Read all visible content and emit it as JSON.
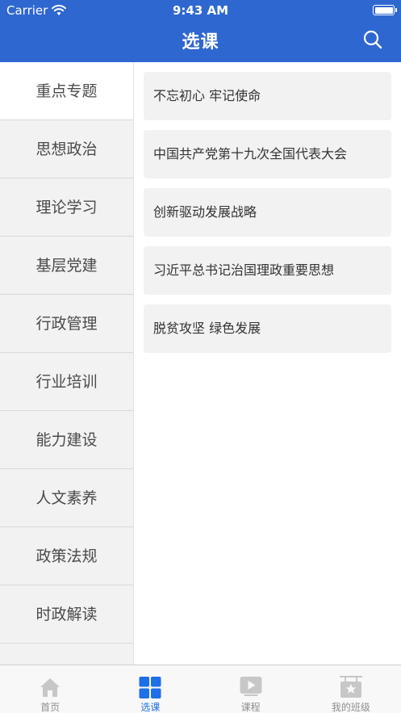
{
  "status_bar": {
    "carrier": "Carrier",
    "time": "9:43 AM"
  },
  "header": {
    "title": "选课",
    "search_icon": "search-icon"
  },
  "sidebar": {
    "items": [
      {
        "label": "重点专题",
        "active": true
      },
      {
        "label": "思想政治"
      },
      {
        "label": "理论学习"
      },
      {
        "label": "基层党建"
      },
      {
        "label": "行政管理"
      },
      {
        "label": "行业培训"
      },
      {
        "label": "能力建设"
      },
      {
        "label": "人文素养"
      },
      {
        "label": "政策法规"
      },
      {
        "label": "时政解读"
      },
      {
        "label": ""
      }
    ]
  },
  "topics": [
    {
      "label": "不忘初心 牢记使命"
    },
    {
      "label": "中国共产党第十九次全国代表大会"
    },
    {
      "label": "创新驱动发展战略"
    },
    {
      "label": "习近平总书记治国理政重要思想"
    },
    {
      "label": "脱贫攻坚 绿色发展"
    }
  ],
  "tabbar": {
    "tabs": [
      {
        "label": "首页",
        "icon": "home-icon"
      },
      {
        "label": "选课",
        "icon": "grid-icon",
        "active": true
      },
      {
        "label": "课程",
        "icon": "play-icon"
      },
      {
        "label": "我的班级",
        "icon": "class-icon"
      }
    ]
  },
  "colors": {
    "primary": "#2f67d0",
    "tab_active": "#1e6fe8",
    "sidebar_bg": "#f2f2f2"
  }
}
